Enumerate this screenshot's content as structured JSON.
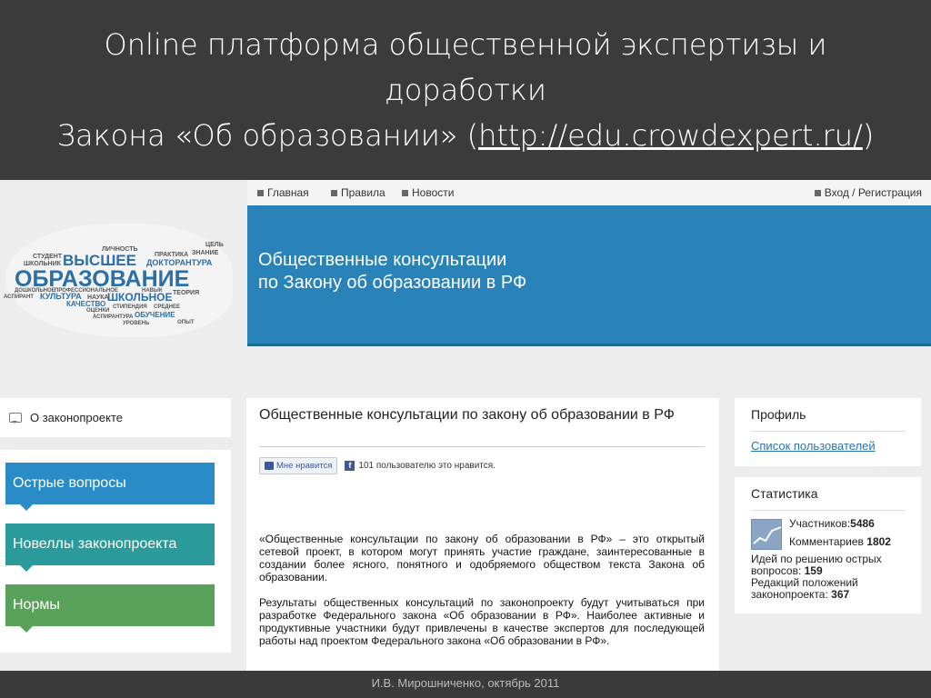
{
  "slide": {
    "title_line1": "Online платформа общественной экспертизы и",
    "title_line2": "доработки",
    "title_line3_prefix": "Закона «Об образовании» (",
    "title_link": "http://edu.crowdexpert.ru/",
    "title_line3_suffix": ")",
    "footer": "И.В. Мирошниченко, октябрь 2011"
  },
  "site": {
    "nav": {
      "main": "Главная",
      "rules": "Правила",
      "news": "Новости",
      "login": "Вход / Регистрация"
    },
    "banner": {
      "line1": "Общественные консультации",
      "line2": "по Закону об образовании в РФ"
    },
    "word_cloud": {
      "w1": "СТУДЕНТ",
      "w2": "ЛИЧНОСТЬ",
      "w3": "ЦЕЛЬ",
      "w4": "ШКОЛЬНИК",
      "w5": "ВЫСШЕЕ",
      "w6": "ПРАКТИКА",
      "w7": "ЗНАНИЕ",
      "w8": "ДОКТОРАНТУРА",
      "w9": "ОБРАЗОВАНИЕ",
      "w10": "ДОШКОЛЬНОЕ",
      "w11": "ПРОФЕССИОНАЛЬНОЕ",
      "w12": "НАВЫК",
      "w13": "ТЕОРИЯ",
      "w14": "АСПИРАНТ",
      "w15": "КУЛЬТУРА",
      "w16": "НАУКА",
      "w17": "ШКОЛЬНОЕ",
      "w18": "КАЧЕСТВО",
      "w19": "ОЦЕНКИ",
      "w20": "СТИПЕНДИЯ",
      "w21": "СРЕДНЕЕ",
      "w22": "АСПИРАНТУРА",
      "w23": "ОБУЧЕНИЕ",
      "w24": "УРОВЕНЬ",
      "w25": "ОПЫТ"
    },
    "left": {
      "about": "О законопроекте",
      "menu": [
        "Острые вопросы",
        "Новеллы законопроекта",
        "Нормы"
      ]
    },
    "content": {
      "title": "Общественные консультации по закону об образовании в РФ",
      "like_button": "Мне нравится",
      "like_count_text": "101 пользователю это нравится.",
      "fb_letter": "f",
      "paragraph1": "«Общественные консультации по закону об образовании в РФ» – это открытый сетевой проект, в котором могут принять участие граждане, заинтересованные в создании более ясного, понятного и одобряемого обществом текста Закона об образовании.",
      "paragraph2": "Результаты общественных консультаций по законопроекту будут учитываться при разработке Федерального закона «Об образовании в РФ». Наиболее активные и продуктивные участники будут привлечены в качестве экспертов для последующей работы над проектом Федерального закона «Об образовании в РФ»."
    },
    "right": {
      "profile_heading": "Профиль",
      "users_link": "Список пользователей",
      "stats_heading": "Статистика",
      "participants_label": "Участников:",
      "participants_value": "5486",
      "comments_label": "Комментариев",
      "comments_value": "1802",
      "ideas_label": "Идей по решению острых вопросов:",
      "ideas_value": "159",
      "edits_label": "Редакций положений законопроекта:",
      "edits_value": "367"
    }
  },
  "colors": {
    "slide_bg": "#3b3b3b",
    "banner": "#2a83b8",
    "btn_issues": "#2a8cc6",
    "btn_novels": "#2a9a9a",
    "btn_norms": "#5aa15a",
    "link": "#2a74b0"
  }
}
